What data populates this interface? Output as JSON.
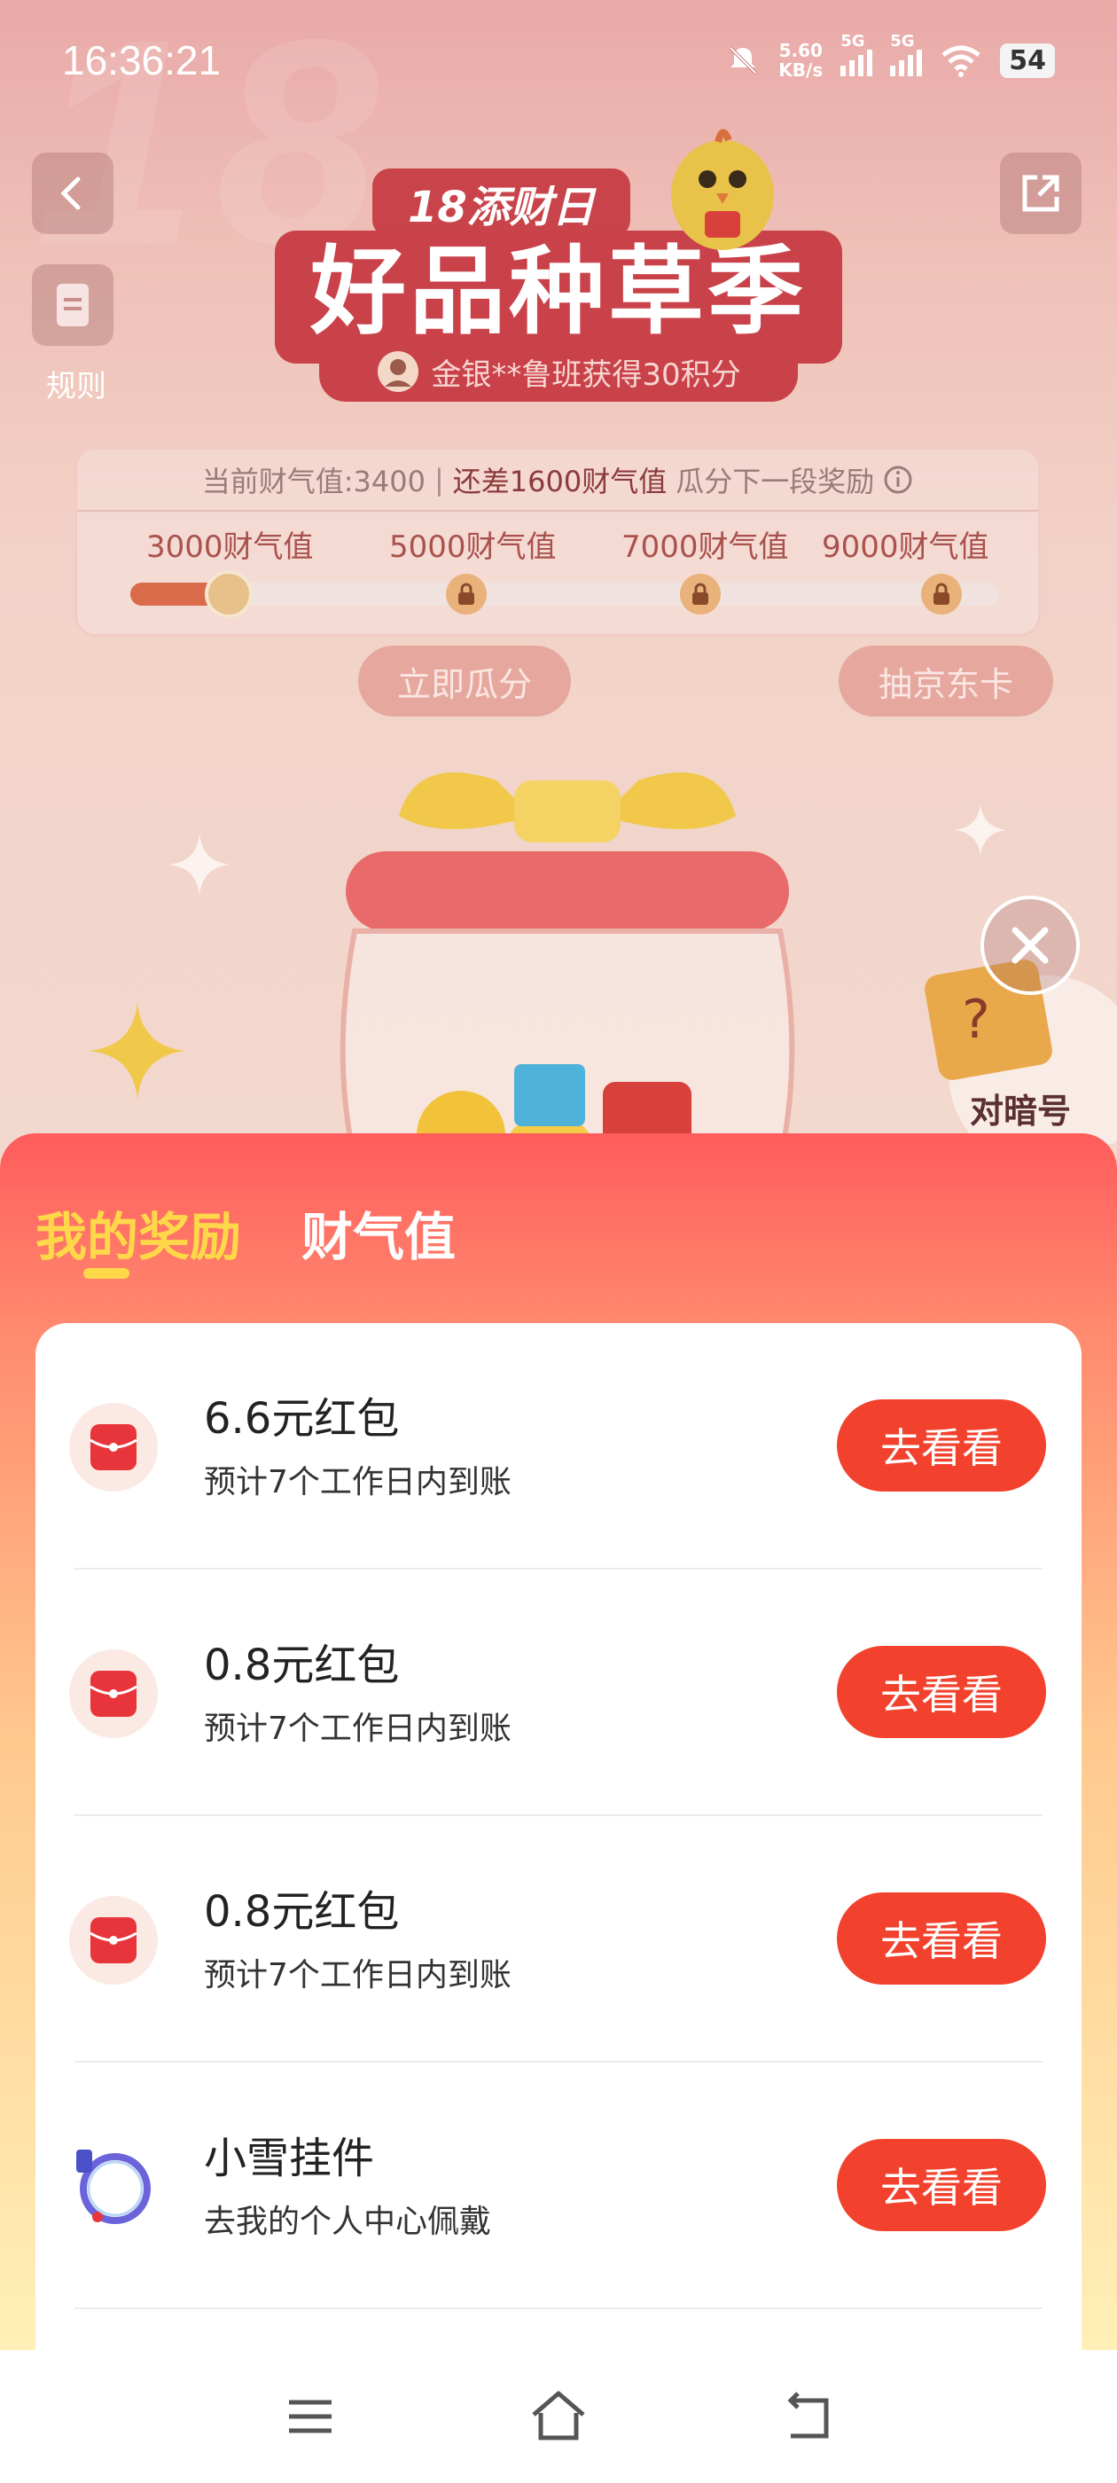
{
  "status_bar": {
    "time": "16:36:21",
    "net_speed_value": "5.60",
    "net_speed_unit": "KB/s",
    "sim1_label": "5G",
    "sim2_label": "5G",
    "battery": "54"
  },
  "header": {
    "rule_label": "规则",
    "event_tag": "18添财日",
    "event_title": "好品种草季",
    "ticker": "金银**鲁班获得30积分"
  },
  "progress": {
    "current_text": "当前财气值:3400",
    "remain_text": "还差1600财气值",
    "remain_suffix": "瓜分下一段奖励",
    "milestones": [
      {
        "label": "3000财气值"
      },
      {
        "label": "5000财气值"
      },
      {
        "label": "7000财气值"
      },
      {
        "label": "9000财气值"
      }
    ],
    "current_value": 3400,
    "next_target": 5000
  },
  "actions": {
    "split_now": "立即瓜分",
    "draw_jd_card": "抽京东卡",
    "code_label": "对暗号"
  },
  "sheet": {
    "tabs": [
      {
        "label": "我的奖励",
        "active": true
      },
      {
        "label": "财气值",
        "active": false
      }
    ],
    "rewards": [
      {
        "title": "6.6元红包",
        "subtitle": "预计7个工作日内到账",
        "button": "去看看",
        "icon": "red-envelope-icon"
      },
      {
        "title": "0.8元红包",
        "subtitle": "预计7个工作日内到账",
        "button": "去看看",
        "icon": "red-envelope-icon"
      },
      {
        "title": "0.8元红包",
        "subtitle": "预计7个工作日内到账",
        "button": "去看看",
        "icon": "red-envelope-icon"
      },
      {
        "title": "小雪挂件",
        "subtitle": "去我的个人中心佩戴",
        "button": "去看看",
        "icon": "avatar-frame-icon"
      }
    ]
  },
  "colors": {
    "accent": "#f2422e",
    "tab_active": "#ffd84a",
    "progress_fill": "#d96a4a"
  }
}
